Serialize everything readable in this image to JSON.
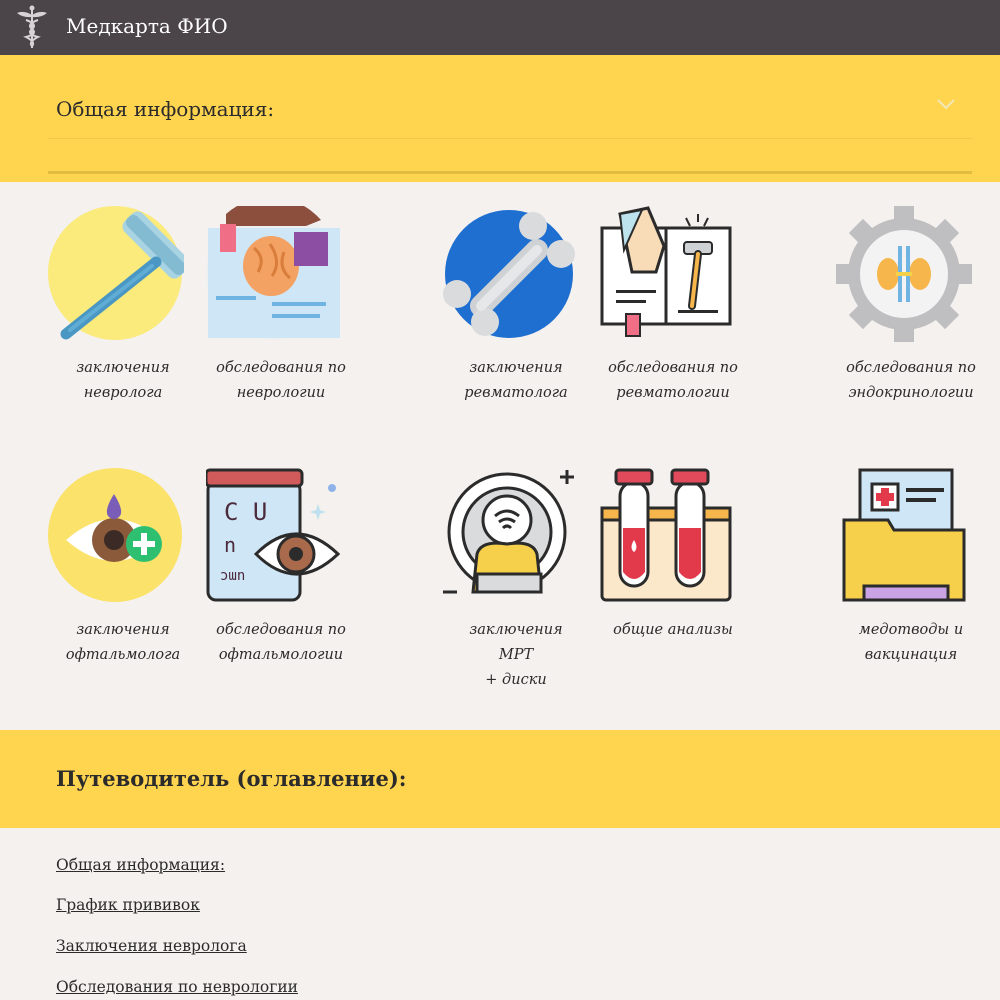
{
  "header": {
    "title": "Медкарта ФИО",
    "logo": "caduceus-icon"
  },
  "accordion": {
    "title": "Общая информация:",
    "chevron": "chevron-down-icon"
  },
  "tiles": [
    {
      "icon": "reflex-hammer-icon",
      "line1": "заключения",
      "line2": "невролога",
      "line3": ""
    },
    {
      "icon": "brain-puzzle-book-icon",
      "line1": "обследования по",
      "line2": "неврологии",
      "line3": ""
    },
    {
      "icon": "bone-icon",
      "line1": "заключения",
      "line2": "ревматолога",
      "line3": ""
    },
    {
      "icon": "knee-reflex-book-icon",
      "line1": "обследования по",
      "line2": "ревматологии",
      "line3": ""
    },
    {
      "icon": "kidneys-gear-icon",
      "line1": "обследования по",
      "line2": "эндокринологии",
      "line3": ""
    },
    {
      "icon": "eye-drop-icon",
      "line1": "заключения",
      "line2": "офтальмолога",
      "line3": ""
    },
    {
      "icon": "eye-chart-icon",
      "line1": "обследования по",
      "line2": "офтальмологии",
      "line3": ""
    },
    {
      "icon": "mri-scanner-icon",
      "line1": "заключения",
      "line2": "МРТ",
      "line3": "+ диски"
    },
    {
      "icon": "test-tubes-icon",
      "line1": "общие анализы",
      "line2": "",
      "line3": ""
    },
    {
      "icon": "medical-folder-icon",
      "line1": "медотводы и",
      "line2": "вакцинация",
      "line3": ""
    }
  ],
  "toc": {
    "title": "Путеводитель (оглавление):",
    "links": [
      "Общая информация:",
      "График прививок",
      "Заключения невролога",
      "Обследования по неврологии"
    ]
  },
  "colors": {
    "topbar": "#4b4549",
    "accent_yellow": "#ffd54f",
    "background": "#f5f1ee"
  }
}
